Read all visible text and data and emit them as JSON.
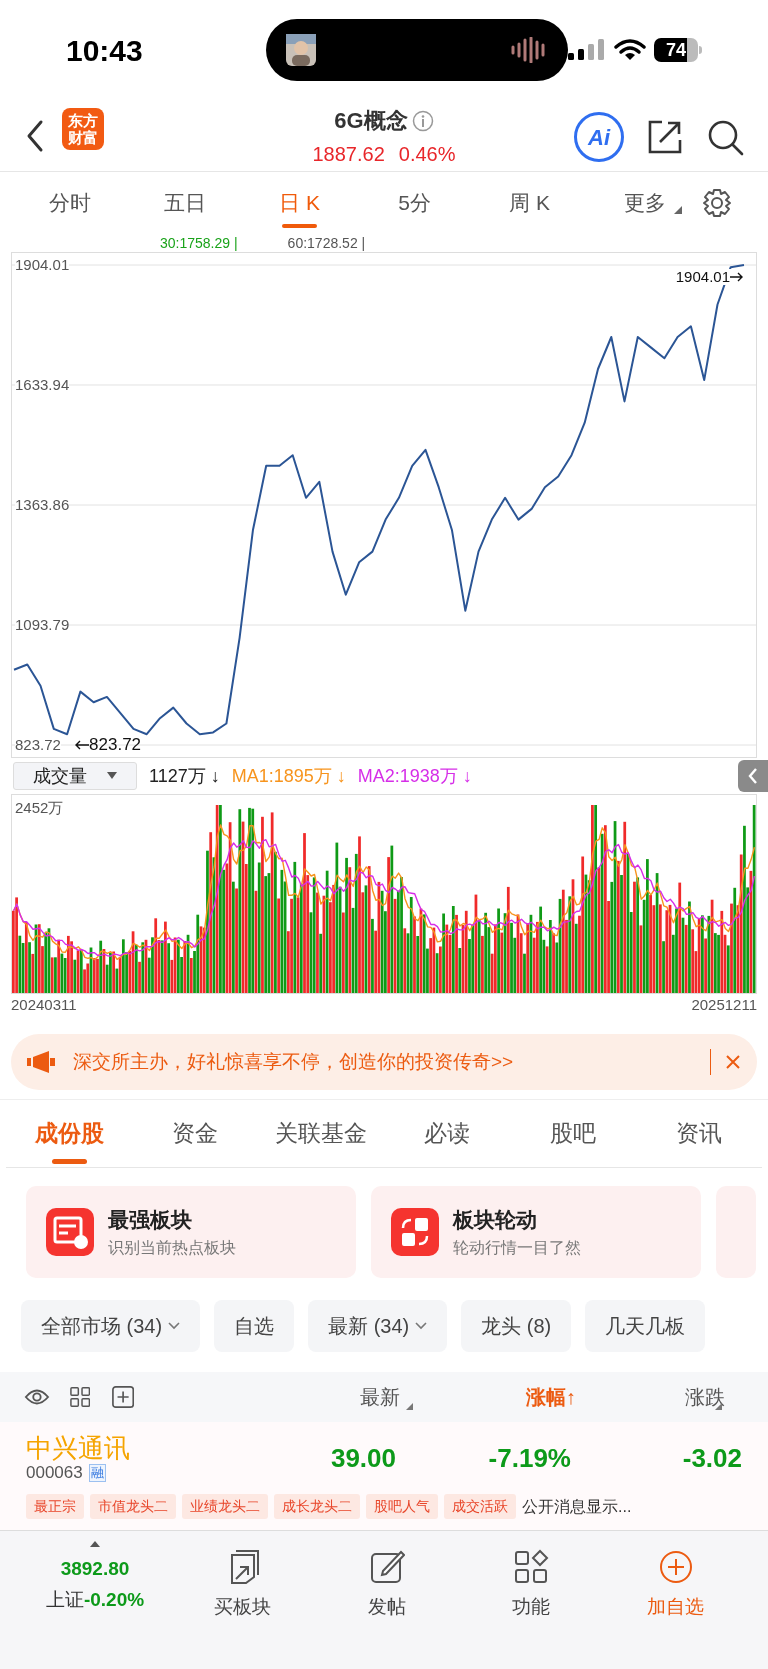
{
  "status_bar": {
    "time": "10:43",
    "battery": "74"
  },
  "header": {
    "logo": [
      "东方",
      "财富"
    ],
    "title": "6G概念",
    "price": "1887.62",
    "change": "0.46%",
    "ai_label": "Ai"
  },
  "period_tabs": [
    {
      "label": "分时",
      "selected": false
    },
    {
      "label": "五日",
      "selected": false
    },
    {
      "label": "日 K",
      "selected": true
    },
    {
      "label": "5分",
      "selected": false
    },
    {
      "label": "周 K",
      "selected": false
    },
    {
      "label": "更多",
      "selected": false,
      "kind": "menu"
    }
  ],
  "ma_legend": [
    {
      "text": "30:1758.29 |",
      "color": "#1aa31a"
    },
    {
      "text": "60:1728.52 |",
      "color": "#555555"
    }
  ],
  "price_chart": {
    "chart_data": {
      "type": "line",
      "grid": true,
      "yticks": [
        1904.01,
        1633.94,
        1363.86,
        1093.79,
        823.72
      ],
      "ylim": [
        823.72,
        1904.01
      ],
      "series": [
        {
          "color": "#2b5595",
          "values": [
            993,
            1005,
            957,
            860,
            848,
            944,
            920,
            932,
            896,
            860,
            848,
            884,
            908,
            872,
            848,
            852,
            872,
            1065,
            1307,
            1452,
            1452,
            1476,
            1380,
            1416,
            1259,
            1162,
            1235,
            1259,
            1331,
            1380,
            1452,
            1488,
            1404,
            1307,
            1126,
            1259,
            1331,
            1380,
            1331,
            1355,
            1404,
            1428,
            1476,
            1549,
            1670,
            1742,
            1597,
            1742,
            1718,
            1694,
            1742,
            1766,
            1645,
            1815,
            1899,
            1904
          ]
        }
      ],
      "annotations": [
        {
          "text": "1904.01"
        },
        {
          "text": "823.72"
        }
      ]
    }
  },
  "volume": {
    "selector": "成交量",
    "current": "1127万 ↓",
    "ma1": "MA1:1895万 ↓",
    "ma2": "MA2:1938万 ↓",
    "max_label": "2452万",
    "start_date": "20240311",
    "end_date": "20251211"
  },
  "banner": {
    "text": "深交所主办，好礼惊喜享不停，创造你的投资传奇>>"
  },
  "section_tabs": [
    {
      "label": "成份股",
      "selected": true
    },
    {
      "label": "资金",
      "selected": false
    },
    {
      "label": "关联基金",
      "selected": false
    },
    {
      "label": "必读",
      "selected": false
    },
    {
      "label": "股吧",
      "selected": false
    },
    {
      "label": "资讯",
      "selected": false
    }
  ],
  "feature_cards": [
    {
      "title": "最强板块",
      "subtitle": "识别当前热点板块",
      "kind": "board"
    },
    {
      "title": "板块轮动",
      "subtitle": "轮动行情一目了然",
      "kind": "rotate"
    }
  ],
  "filters": [
    {
      "label": "全部市场 (34)",
      "dropdown": true
    },
    {
      "label": "自选",
      "dropdown": false
    },
    {
      "label": "最新 (34)",
      "dropdown": true
    },
    {
      "label": "龙头 (8)",
      "dropdown": false
    },
    {
      "label": "几天几板",
      "dropdown": false
    }
  ],
  "columns": [
    {
      "label": "最新",
      "active": false
    },
    {
      "label": "涨幅↑",
      "active": true
    },
    {
      "label": "涨跌",
      "active": false
    }
  ],
  "stocks": [
    {
      "name": "中兴通讯",
      "code": "000063",
      "badge": "融",
      "latest": "39.00",
      "change_pct": "-7.19%",
      "change": "-3.02",
      "tags": [
        "最正宗",
        "市值龙头二",
        "业绩龙头二",
        "成长龙头二",
        "股吧人气",
        "成交活跃"
      ],
      "news": "公开消息显示..."
    }
  ],
  "bottom_bar": {
    "index_value": "3892.80",
    "index_name": "上证",
    "index_change": "-0.20%",
    "actions": [
      {
        "label": "买板块",
        "kind": "board",
        "highlighted": false
      },
      {
        "label": "发帖",
        "kind": "post",
        "highlighted": false
      },
      {
        "label": "功能",
        "kind": "apps",
        "highlighted": false
      },
      {
        "label": "加自选",
        "kind": "add",
        "highlighted": true
      }
    ]
  }
}
